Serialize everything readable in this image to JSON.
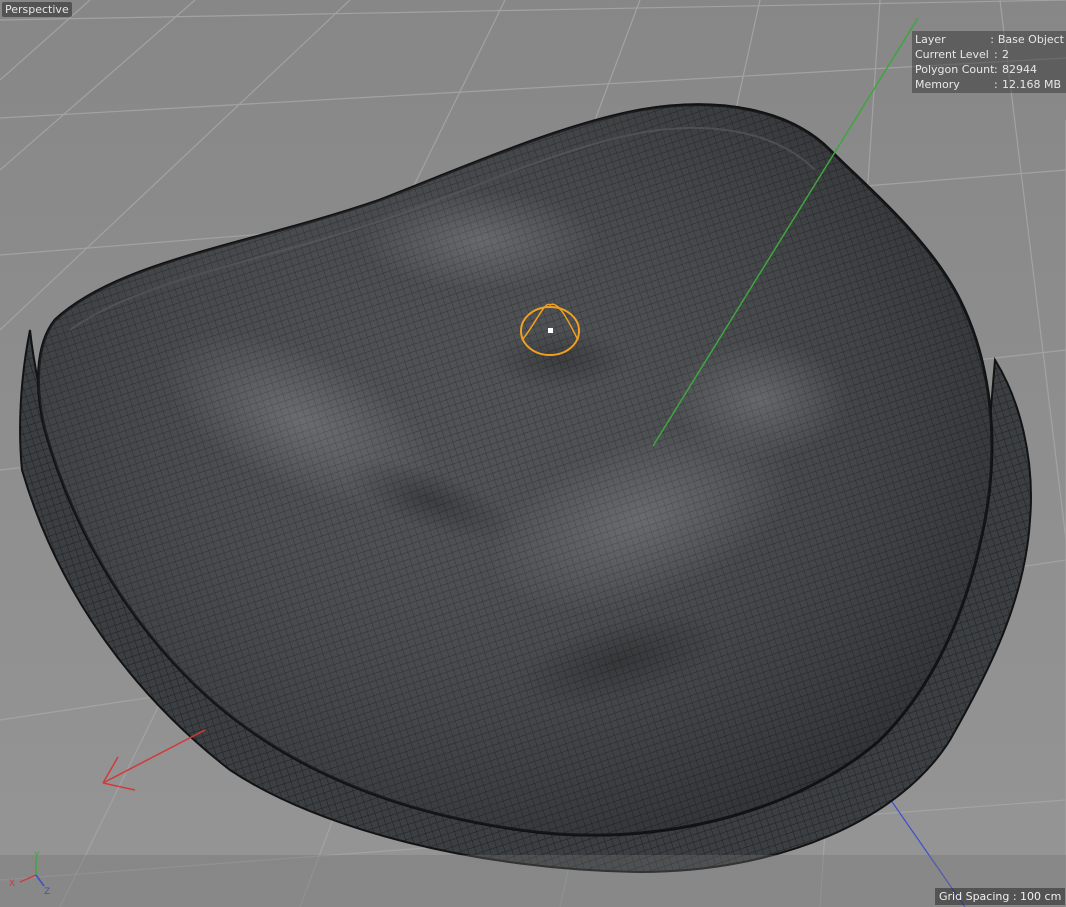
{
  "viewport": {
    "view_name": "Perspective",
    "grid_spacing": "Grid Spacing : 100 cm"
  },
  "hud": {
    "rows": [
      {
        "key": "Layer",
        "value": "Base Object"
      },
      {
        "key": "Current Level",
        "value": "2"
      },
      {
        "key": "Polygon Count",
        "value": "82944"
      },
      {
        "key": "Memory",
        "value": "12.168 MB"
      }
    ],
    "separator": ":"
  },
  "axis_gizmo": {
    "x_label": "X",
    "y_label": "Y",
    "z_label": "Z"
  },
  "colors": {
    "background": "#8e8e8e",
    "grid_line": "#a3a3a3",
    "mesh_fill": "#3d4043",
    "mesh_wire": "#1c1d1f",
    "axis_x": "#d03a3a",
    "axis_y": "#3fa53f",
    "axis_z": "#3a4fd0",
    "brush_cursor": "#f0a020"
  },
  "icons": {
    "brush_cursor": "sculpt-brush-cursor-icon",
    "axis_gizmo": "world-axis-gizmo-icon"
  }
}
